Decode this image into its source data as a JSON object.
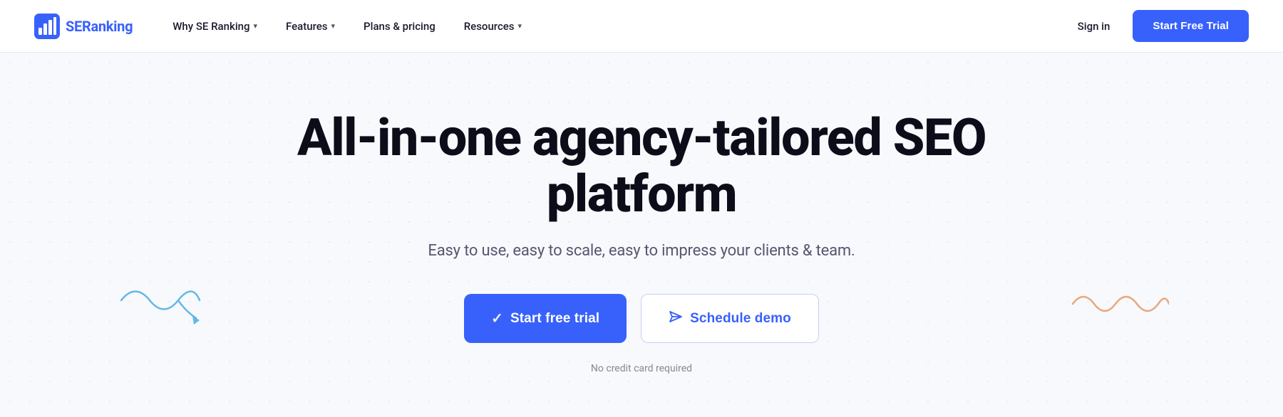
{
  "navbar": {
    "logo_brand": "SE",
    "logo_suffix": "Ranking",
    "nav_items": [
      {
        "label": "Why SE Ranking",
        "has_dropdown": true
      },
      {
        "label": "Features",
        "has_dropdown": true
      },
      {
        "label": "Plans & pricing",
        "has_dropdown": false
      },
      {
        "label": "Resources",
        "has_dropdown": true
      }
    ],
    "sign_in_label": "Sign in",
    "cta_label": "Start Free Trial"
  },
  "hero": {
    "title": "All-in-one agency-tailored SEO platform",
    "subtitle": "Easy to use, easy to scale, easy to impress your clients & team.",
    "cta_primary": "Start free trial",
    "cta_secondary": "Schedule demo",
    "no_cc_text": "No credit card required"
  },
  "icons": {
    "chevron": "▾",
    "check_circle": "✓",
    "send": "➤"
  }
}
